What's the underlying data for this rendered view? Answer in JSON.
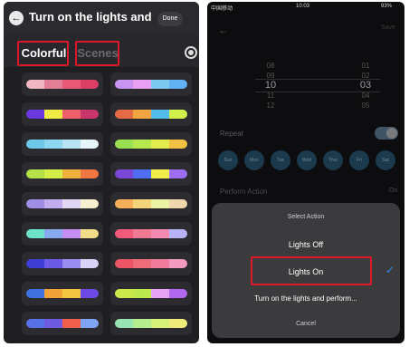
{
  "left": {
    "title": "Turn on the lights and ...",
    "done_label": "Done",
    "tabs": {
      "colorful": "Colorful",
      "scenes": "Scenes"
    },
    "palettes": [
      [
        "#f1b8c4",
        "#e27f96",
        "#e85a77",
        "#db3f66"
      ],
      [
        "#c993f1",
        "#e7a0f2",
        "#7ec9ef",
        "#63b3f4"
      ],
      [
        "#6b38e0",
        "#f1ea45",
        "#ee5f6c",
        "#c9366a"
      ],
      [
        "#e56b45",
        "#f0a541",
        "#54bceb",
        "#d2f04b"
      ],
      [
        "#6dc9ea",
        "#8dd7f0",
        "#b7e3f2",
        "#e6f5f8"
      ],
      [
        "#9ae053",
        "#b8e84f",
        "#e2ed4b",
        "#f0c143"
      ],
      [
        "#b4e14a",
        "#d6ee4a",
        "#f0b03f",
        "#ef7742"
      ],
      [
        "#7b47d9",
        "#4f6df0",
        "#f0ec4a",
        "#9d6cf0"
      ],
      [
        "#a08de6",
        "#c1adf0",
        "#e2d7f3",
        "#f5efd0"
      ],
      [
        "#f6b05a",
        "#f4d57a",
        "#eaf3a1",
        "#f0d6ad"
      ],
      [
        "#6de3c8",
        "#87a9ee",
        "#c58ef2",
        "#f3dc88"
      ],
      [
        "#f25a7a",
        "#f07a94",
        "#f48ab0",
        "#b8b2f7"
      ],
      [
        "#3f3fd5",
        "#6a5ae6",
        "#9b8df0",
        "#d8d2f6"
      ],
      [
        "#ea5464",
        "#ec6d78",
        "#f07b9c",
        "#f29ac0"
      ],
      [
        "#3f72e0",
        "#f0a138",
        "#f2c640",
        "#6d4ae6"
      ],
      [
        "#cbe84b",
        "#bde94e",
        "#e6a2f5",
        "#b069ee"
      ],
      [
        "#5772e8",
        "#6e5be0",
        "#ef5e4b",
        "#7ea4f3"
      ],
      [
        "#98e3b2",
        "#b5ec8f",
        "#d6f07a",
        "#f0ec7b"
      ]
    ]
  },
  "right": {
    "status_left": "中国移动",
    "status_time": "10:03",
    "status_right": "93%",
    "save_label": "Save",
    "picker": {
      "rows": [
        {
          "h": "08",
          "m": "01"
        },
        {
          "h": "09",
          "m": "02"
        },
        {
          "h": "10",
          "m": "03"
        },
        {
          "h": "11",
          "m": "04"
        },
        {
          "h": "12",
          "m": "05"
        }
      ],
      "selected_index": 2
    },
    "repeat_label": "Repeat",
    "days": [
      "Sun",
      "Mon",
      "Tue",
      "Wed",
      "Thur",
      "Fri",
      "Sat"
    ],
    "perform_label": "Perform Action",
    "perform_value": "On"
  },
  "sheet": {
    "title": "Select Action",
    "options": [
      "Lights Off",
      "Lights On",
      "Turn on the lights and perform..."
    ],
    "cancel_label": "Cancel",
    "selected_index": 1
  },
  "colors": {
    "highlight_red": "#e0162a",
    "check_blue": "#2d8cf0"
  }
}
